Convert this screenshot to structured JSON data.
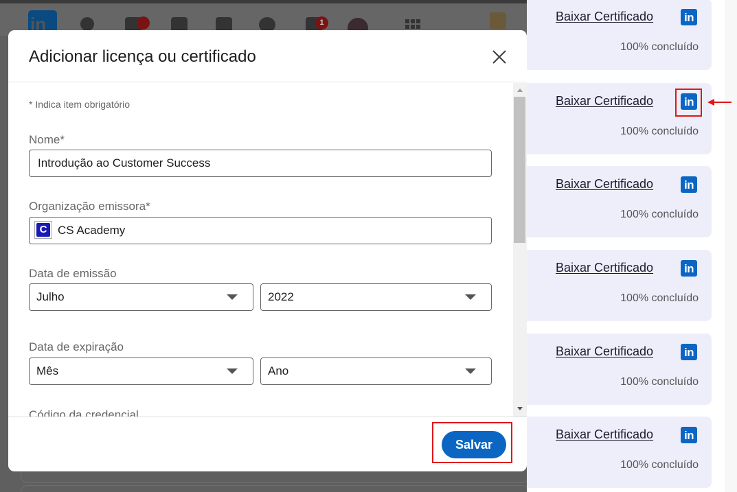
{
  "modal": {
    "title": "Adicionar licença ou certificado",
    "close_label": "Fechar",
    "required_note": "* Indica item obrigatório",
    "name": {
      "label": "Nome*",
      "value": "Introdução ao Customer Success"
    },
    "organization": {
      "label": "Organização emissora*",
      "value": "CS Academy",
      "logo_letter": "C"
    },
    "issue_date": {
      "label": "Data de emissão",
      "month": "Julho",
      "year": "2022"
    },
    "expiration_date": {
      "label": "Data de expiração",
      "month": "Mês",
      "year": "Ano"
    },
    "credential_code_label": "Código da credencial",
    "save_label": "Salvar"
  },
  "linkedin_nav": {
    "notification_badges": [
      "",
      "1"
    ]
  },
  "certificates": [
    {
      "link": "Baixar Certificado",
      "progress": "100% concluído",
      "icon_text": "in"
    },
    {
      "link": "Baixar Certificado",
      "progress": "100% concluído",
      "icon_text": "in"
    },
    {
      "link": "Baixar Certificado",
      "progress": "100% concluído",
      "icon_text": "in"
    },
    {
      "link": "Baixar Certificado",
      "progress": "100% concluído",
      "icon_text": "in"
    },
    {
      "link": "Baixar Certificado",
      "progress": "100% concluído",
      "icon_text": "in"
    },
    {
      "link": "Baixar Certificado",
      "progress": "100% concluído",
      "icon_text": "in"
    }
  ],
  "colors": {
    "linkedin_blue": "#0a66c2",
    "highlight_red": "#e0161b",
    "card_background": "#eeeefb"
  }
}
